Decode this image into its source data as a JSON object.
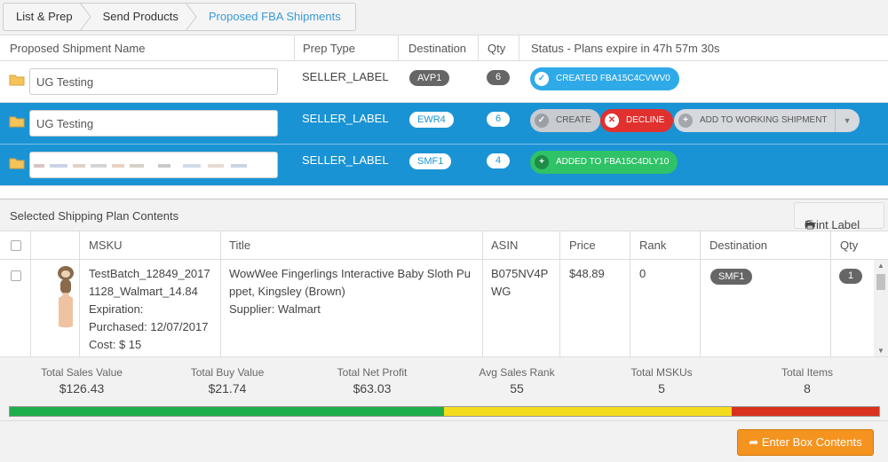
{
  "breadcrumb": [
    "List & Prep",
    "Send Products",
    "Proposed FBA Shipments"
  ],
  "shipments": {
    "headers": {
      "name": "Proposed Shipment Name",
      "prep": "Prep Type",
      "destination": "Destination",
      "qty": "Qty",
      "status": "Status - Plans expire in 47h 57m 30s"
    },
    "rows": [
      {
        "name": "UG Testing",
        "prep": "SELLER_LABEL",
        "destination": "AVP1",
        "qty": "6",
        "status_label": "CREATED FBA15C4CVWV0"
      },
      {
        "name": "UG Testing",
        "prep": "SELLER_LABEL",
        "destination": "EWR4",
        "qty": "6",
        "create_label": "CREATE",
        "decline_label": "DECLINE",
        "add_label": "ADD TO WORKING SHIPMENT"
      },
      {
        "name": "",
        "prep": "SELLER_LABEL",
        "destination": "SMF1",
        "qty": "4",
        "status_label": "ADDED TO FBA15C4DLY10"
      }
    ]
  },
  "plan": {
    "title": "Selected Shipping Plan Contents",
    "print_label": "Print Label",
    "headers": {
      "msku": "MSKU",
      "title": "Title",
      "asin": "ASIN",
      "price": "Price",
      "rank": "Rank",
      "destination": "Destination",
      "qty": "Qty"
    },
    "item": {
      "msku_lines": [
        "TestBatch_12849_2017",
        "1128_Walmart_14.84",
        "Expiration:",
        "Purchased: 12/07/2017",
        "Cost: $ 15"
      ],
      "title_lines": [
        "WowWee Fingerlings Interactive Baby Sloth Pu",
        "ppet, Kingsley (Brown)",
        "Supplier: Walmart"
      ],
      "asin_lines": [
        "B075NV4P",
        "WG"
      ],
      "price": "$48.89",
      "rank": "0",
      "destination": "SMF1",
      "qty": "1"
    }
  },
  "totals": [
    {
      "label": "Total Sales Value",
      "value": "$126.43"
    },
    {
      "label": "Total Buy Value",
      "value": "$21.74"
    },
    {
      "label": "Total Net Profit",
      "value": "$63.03"
    },
    {
      "label": "Avg Sales Rank",
      "value": "55"
    },
    {
      "label": "Total MSKUs",
      "value": "5"
    },
    {
      "label": "Total Items",
      "value": "8"
    }
  ],
  "progress_fractions": {
    "green": 0.499,
    "yellow": 0.331,
    "red": 0.17
  },
  "colors": {
    "green": "#1fae4b",
    "yellow": "#f2dc1d",
    "red": "#d9321f",
    "accent": "#1a93d4",
    "orange": "#f5931f"
  },
  "footer": {
    "enter_label": "Enter Box Contents"
  }
}
